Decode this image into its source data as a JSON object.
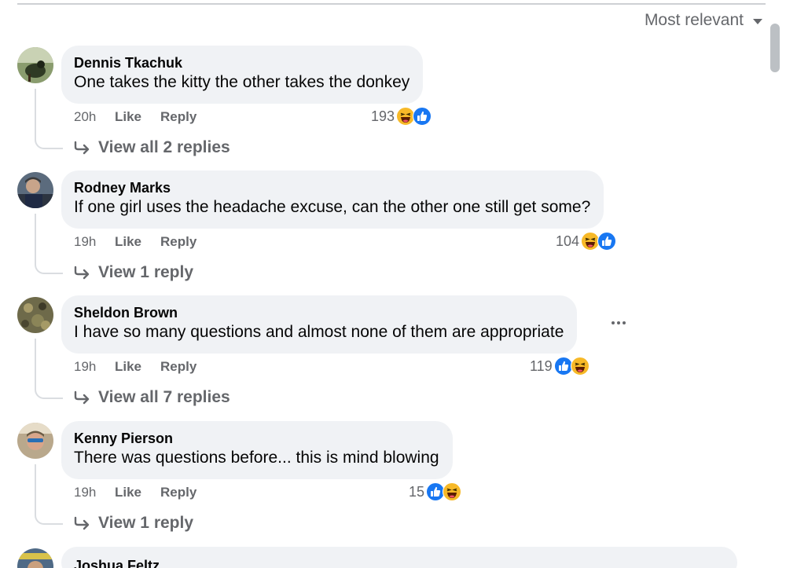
{
  "sort": {
    "label": "Most relevant",
    "icon": "chevron-down-icon"
  },
  "comments": [
    {
      "author": "Dennis Tkachuk",
      "text": "One takes the kitty the other takes the donkey",
      "time": "20h",
      "like_label": "Like",
      "reply_label": "Reply",
      "reaction_count": "193",
      "reactions": [
        "haha",
        "like"
      ],
      "replies_label": "View all 2 replies"
    },
    {
      "author": "Rodney Marks",
      "text": "If one girl uses the headache excuse, can the other one still get some?",
      "time": "19h",
      "like_label": "Like",
      "reply_label": "Reply",
      "reaction_count": "104",
      "reactions": [
        "haha",
        "like"
      ],
      "replies_label": "View 1 reply"
    },
    {
      "author": "Sheldon Brown",
      "text": "I have so many questions and almost none of them are appropriate",
      "time": "19h",
      "like_label": "Like",
      "reply_label": "Reply",
      "reaction_count": "119",
      "reactions": [
        "like",
        "haha"
      ],
      "replies_label": "View all 7 replies"
    },
    {
      "author": "Kenny Pierson",
      "text": "There was questions before... this is mind blowing",
      "time": "19h",
      "like_label": "Like",
      "reply_label": "Reply",
      "reaction_count": "15",
      "reactions": [
        "like",
        "haha"
      ],
      "replies_label": "View 1 reply"
    },
    {
      "author": "Joshua Feltz"
    }
  ],
  "colors": {
    "like_blue": "#1877f2",
    "haha_yellow": "#f7b928",
    "meta_gray": "#65676b",
    "bubble_bg": "#f0f2f5"
  }
}
